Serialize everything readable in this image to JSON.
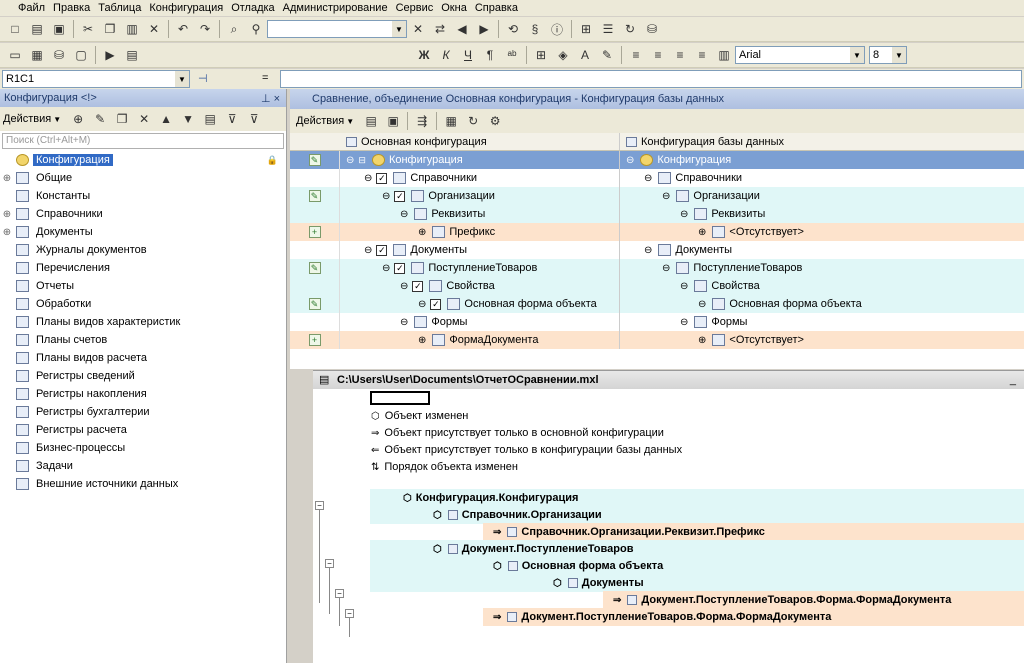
{
  "menu": [
    "Файл",
    "Правка",
    "Таблица",
    "Конфигурация",
    "Отладка",
    "Администрирование",
    "Сервис",
    "Окна",
    "Справка"
  ],
  "font": {
    "name": "Arial",
    "size": "8"
  },
  "cell_ref": "R1C1",
  "formula_eq": "=",
  "left_panel": {
    "title": "Конфигурация <!>",
    "pin": "⊥ ×",
    "actions_label": "Действия",
    "search_placeholder": "Поиск (Ctrl+Alt+M)",
    "items": [
      {
        "label": "Конфигурация",
        "selected": true,
        "icon": "config-icon"
      },
      {
        "label": "Общие",
        "expandable": true,
        "icon": "common-icon"
      },
      {
        "label": "Константы",
        "icon": "constants-icon"
      },
      {
        "label": "Справочники",
        "expandable": true,
        "icon": "catalog-icon"
      },
      {
        "label": "Документы",
        "expandable": true,
        "icon": "document-icon"
      },
      {
        "label": "Журналы документов",
        "icon": "journal-icon"
      },
      {
        "label": "Перечисления",
        "icon": "enum-icon"
      },
      {
        "label": "Отчеты",
        "icon": "report-icon"
      },
      {
        "label": "Обработки",
        "icon": "processing-icon"
      },
      {
        "label": "Планы видов характеристик",
        "icon": "chart-characteristics-icon"
      },
      {
        "label": "Планы счетов",
        "icon": "chart-accounts-icon"
      },
      {
        "label": "Планы видов расчета",
        "icon": "chart-calc-icon"
      },
      {
        "label": "Регистры сведений",
        "icon": "info-register-icon"
      },
      {
        "label": "Регистры накопления",
        "icon": "accum-register-icon"
      },
      {
        "label": "Регистры бухгалтерии",
        "icon": "account-register-icon"
      },
      {
        "label": "Регистры расчета",
        "icon": "calc-register-icon"
      },
      {
        "label": "Бизнес-процессы",
        "icon": "business-process-icon"
      },
      {
        "label": "Задачи",
        "icon": "task-icon"
      },
      {
        "label": "Внешние источники данных",
        "icon": "external-source-icon"
      }
    ]
  },
  "compare": {
    "title": "Сравнение, объединение Основная конфигурация - Конфигурация базы данных",
    "actions_label": "Действия",
    "col_main": "Основная конфигурация",
    "col_db": "Конфигурация базы данных",
    "rows": [
      {
        "style": "blue",
        "mark": "✎",
        "main": "Конфигурация",
        "db": "Конфигурация",
        "indent": 0,
        "check": false
      },
      {
        "style": "white",
        "mark": "",
        "main": "Справочники",
        "db": "Справочники",
        "indent": 1,
        "check": true
      },
      {
        "style": "cyan",
        "mark": "✎",
        "main": "Организации",
        "db": "Организации",
        "indent": 2,
        "check": true
      },
      {
        "style": "cyan",
        "mark": "",
        "main": "Реквизиты",
        "db": "Реквизиты",
        "indent": 3,
        "check": false
      },
      {
        "style": "peach",
        "mark": "+",
        "main": "Префикс",
        "db": "<Отсутствует>",
        "indent": 4,
        "check": false
      },
      {
        "style": "white",
        "mark": "",
        "main": "Документы",
        "db": "Документы",
        "indent": 1,
        "check": true
      },
      {
        "style": "cyan",
        "mark": "✎",
        "main": "ПоступлениеТоваров",
        "db": "ПоступлениеТоваров",
        "indent": 2,
        "check": true
      },
      {
        "style": "cyan",
        "mark": "",
        "main": "Свойства",
        "db": "Свойства",
        "indent": 3,
        "check": true
      },
      {
        "style": "cyan",
        "mark": "✎",
        "main": "Основная форма объекта",
        "db": "Основная форма объекта",
        "indent": 4,
        "check": true
      },
      {
        "style": "white",
        "mark": "",
        "main": "Формы",
        "db": "Формы",
        "indent": 3,
        "check": false
      },
      {
        "style": "peach",
        "mark": "+",
        "main": "ФормаДокумента",
        "db": "<Отсутствует>",
        "indent": 4,
        "check": false
      }
    ]
  },
  "report": {
    "title": "C:\\Users\\User\\Documents\\ОтчетОСравнении.mxl",
    "legend": [
      {
        "icon": "changed-icon",
        "text": "Объект изменен"
      },
      {
        "icon": "only-main-icon",
        "text": "Объект присутствует только в основной конфигурации"
      },
      {
        "icon": "only-db-icon",
        "text": "Объект присутствует только в конфигурации базы данных"
      },
      {
        "icon": "order-changed-icon",
        "text": "Порядок объекта изменен"
      }
    ],
    "tree": [
      {
        "text": "Конфигурация.Конфигурация",
        "band": "cyan"
      },
      {
        "text": "Справочник.Организации",
        "band": "cyan"
      },
      {
        "text": "Справочник.Организации.Реквизит.Префикс",
        "band": "peach"
      },
      {
        "text": "Документ.ПоступлениеТоваров",
        "band": "cyan"
      },
      {
        "text": "Основная форма объекта",
        "band": "cyan"
      },
      {
        "text": "Документы",
        "band": "cyan"
      },
      {
        "text": "Документ.ПоступлениеТоваров.Форма.ФормаДокумента",
        "band": "peach"
      },
      {
        "text": "Документ.ПоступлениеТоваров.Форма.ФормаДокумента",
        "band": "peach"
      }
    ]
  }
}
